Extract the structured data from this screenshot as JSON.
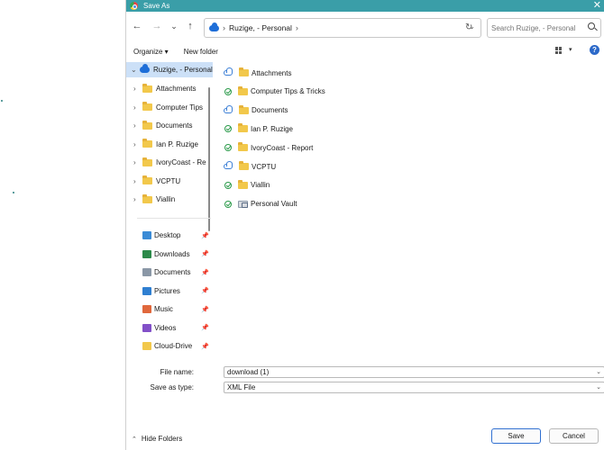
{
  "dialog": {
    "title": "Save As",
    "close_glyph": "✕"
  },
  "nav": {
    "back": "←",
    "forward": "→",
    "recent": "⌄",
    "up": "↑",
    "address_segment": "Ruzige, - Personal",
    "search_placeholder": "Search Ruzige, - Personal"
  },
  "toolbar": {
    "organize": "Organize ▾",
    "new_folder": "New folder",
    "help": "?"
  },
  "tree": {
    "root": "Ruzige, - Personal",
    "children": [
      "Attachments",
      "Computer Tips",
      "Documents",
      "Ian P. Ruzige",
      "IvoryCoast - Re",
      "VCPTU",
      "Viallin"
    ]
  },
  "quick_access": [
    {
      "label": "Desktop",
      "icon": "desktop-icon",
      "color": "#3a8bd6"
    },
    {
      "label": "Downloads",
      "icon": "download-icon",
      "color": "#2c8a4a"
    },
    {
      "label": "Documents",
      "icon": "documents-icon",
      "color": "#8a97a6"
    },
    {
      "label": "Pictures",
      "icon": "pictures-icon",
      "color": "#2f7fd1"
    },
    {
      "label": "Music",
      "icon": "music-icon",
      "color": "#e0683c"
    },
    {
      "label": "Videos",
      "icon": "videos-icon",
      "color": "#8250c8"
    },
    {
      "label": "Cloud-Drive",
      "icon": "folder-icon",
      "color": "#f2c84b"
    }
  ],
  "items": [
    {
      "name": "Attachments",
      "status": "cloud"
    },
    {
      "name": "Computer Tips & Tricks",
      "status": "synced"
    },
    {
      "name": "Documents",
      "status": "cloud"
    },
    {
      "name": "Ian P. Ruzige",
      "status": "synced"
    },
    {
      "name": "IvoryCoast - Report",
      "status": "synced"
    },
    {
      "name": "VCPTU",
      "status": "cloud"
    },
    {
      "name": "Viallin",
      "status": "synced"
    },
    {
      "name": "Personal Vault",
      "status": "synced",
      "vault": true
    }
  ],
  "fields": {
    "file_name_label": "File name:",
    "file_name_value": "download (1)",
    "type_label": "Save as type:",
    "type_value": "XML File"
  },
  "footer": {
    "hide_folders": "Hide Folders",
    "save": "Save",
    "cancel": "Cancel"
  },
  "colors": {
    "titlebar": "#3a9ea8",
    "accent": "#2f6fd0",
    "selection": "#cce0f7"
  }
}
